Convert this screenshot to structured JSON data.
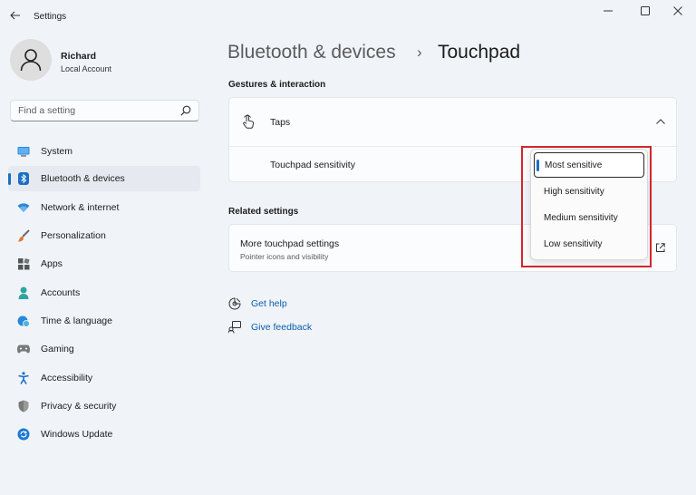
{
  "window": {
    "title": "Settings"
  },
  "user": {
    "name": "Richard",
    "account_type": "Local Account"
  },
  "search": {
    "placeholder": "Find a setting"
  },
  "sidebar": {
    "items": [
      {
        "label": "System",
        "icon": "monitor-icon"
      },
      {
        "label": "Bluetooth & devices",
        "icon": "bluetooth-icon",
        "active": true
      },
      {
        "label": "Network & internet",
        "icon": "wifi-icon"
      },
      {
        "label": "Personalization",
        "icon": "brush-icon"
      },
      {
        "label": "Apps",
        "icon": "apps-icon"
      },
      {
        "label": "Accounts",
        "icon": "person-icon"
      },
      {
        "label": "Time & language",
        "icon": "globe-clock-icon"
      },
      {
        "label": "Gaming",
        "icon": "gamepad-icon"
      },
      {
        "label": "Accessibility",
        "icon": "accessibility-icon"
      },
      {
        "label": "Privacy & security",
        "icon": "shield-icon"
      },
      {
        "label": "Windows Update",
        "icon": "update-icon"
      }
    ]
  },
  "breadcrumb": {
    "parent": "Bluetooth & devices",
    "separator": "›",
    "current": "Touchpad"
  },
  "gestures": {
    "section_title": "Gestures & interaction",
    "taps_label": "Taps",
    "sensitivity_label": "Touchpad sensitivity"
  },
  "dropdown": {
    "selected": "Most sensitive",
    "options": [
      "Most sensitive",
      "High sensitivity",
      "Medium sensitivity",
      "Low sensitivity"
    ]
  },
  "related": {
    "section_title": "Related settings",
    "more_title": "More touchpad settings",
    "more_subtitle": "Pointer icons and visibility"
  },
  "help": {
    "get_help": "Get help",
    "give_feedback": "Give feedback"
  },
  "colors": {
    "accent": "#1a6fc7",
    "highlight": "#d1262f",
    "background": "#f0f4f9"
  }
}
